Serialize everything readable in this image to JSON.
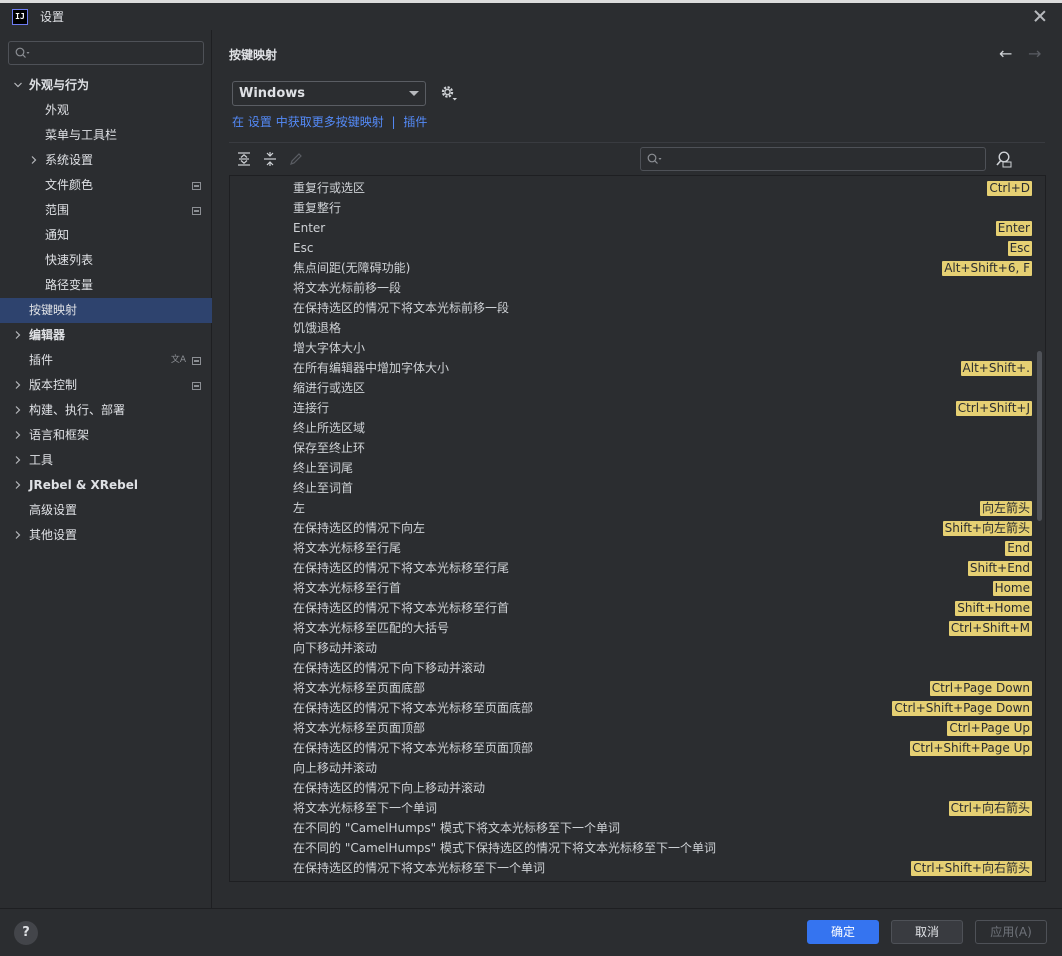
{
  "window": {
    "title": "设置",
    "logo_text": "IJ"
  },
  "sidebar": {
    "search_placeholder": "",
    "items": [
      {
        "label": "外观与行为",
        "level": 0,
        "expanded": true,
        "bold": true
      },
      {
        "label": "外观",
        "level": 1
      },
      {
        "label": "菜单与工具栏",
        "level": 1
      },
      {
        "label": "系统设置",
        "level": 1,
        "collapsed": true
      },
      {
        "label": "文件颜色",
        "level": 1,
        "icon": "project-scope-icon"
      },
      {
        "label": "范围",
        "level": 1,
        "icon": "project-scope-icon"
      },
      {
        "label": "通知",
        "level": 1
      },
      {
        "label": "快速列表",
        "level": 1
      },
      {
        "label": "路径变量",
        "level": 1
      },
      {
        "label": "按键映射",
        "level": 0,
        "selected": true
      },
      {
        "label": "编辑器",
        "level": 0,
        "collapsed": true,
        "bold": true
      },
      {
        "label": "插件",
        "level": 0,
        "icon": "project-scope-icon",
        "translate_icon": true
      },
      {
        "label": "版本控制",
        "level": 0,
        "collapsed": true,
        "icon": "project-scope-icon"
      },
      {
        "label": "构建、执行、部署",
        "level": 0,
        "collapsed": true
      },
      {
        "label": "语言和框架",
        "level": 0,
        "collapsed": true
      },
      {
        "label": "工具",
        "level": 0,
        "collapsed": true
      },
      {
        "label": "JRebel & XRebel",
        "level": 0,
        "collapsed": true,
        "bold": true
      },
      {
        "label": "高级设置",
        "level": 0
      },
      {
        "label": "其他设置",
        "level": 0,
        "collapsed": true
      }
    ]
  },
  "main": {
    "title": "按键映射",
    "keymap_value": "Windows",
    "link": {
      "prefix": "在",
      "settings": "设置",
      "middle": "中获取更多按键映射",
      "sep": "|",
      "plugins": "插件"
    },
    "filter_placeholder": "",
    "actions": [
      {
        "label": "重复行或选区",
        "shortcut": "Ctrl+D"
      },
      {
        "label": "重复整行",
        "shortcut": ""
      },
      {
        "label": "Enter",
        "shortcut": "Enter"
      },
      {
        "label": "Esc",
        "shortcut": "Esc"
      },
      {
        "label": "焦点间距(无障碍功能)",
        "shortcut": "Alt+Shift+6, F"
      },
      {
        "label": "将文本光标前移一段",
        "shortcut": ""
      },
      {
        "label": "在保持选区的情况下将文本光标前移一段",
        "shortcut": ""
      },
      {
        "label": "饥饿退格",
        "shortcut": ""
      },
      {
        "label": "增大字体大小",
        "shortcut": ""
      },
      {
        "label": "在所有编辑器中增加字体大小",
        "shortcut": "Alt+Shift+."
      },
      {
        "label": "缩进行或选区",
        "shortcut": ""
      },
      {
        "label": "连接行",
        "shortcut": "Ctrl+Shift+J"
      },
      {
        "label": "终止所选区域",
        "shortcut": ""
      },
      {
        "label": "保存至终止环",
        "shortcut": ""
      },
      {
        "label": "终止至词尾",
        "shortcut": ""
      },
      {
        "label": "终止至词首",
        "shortcut": ""
      },
      {
        "label": "左",
        "shortcut": "向左箭头"
      },
      {
        "label": "在保持选区的情况下向左",
        "shortcut": "Shift+向左箭头"
      },
      {
        "label": "将文本光标移至行尾",
        "shortcut": "End"
      },
      {
        "label": "在保持选区的情况下将文本光标移至行尾",
        "shortcut": "Shift+End"
      },
      {
        "label": "将文本光标移至行首",
        "shortcut": "Home"
      },
      {
        "label": "在保持选区的情况下将文本光标移至行首",
        "shortcut": "Shift+Home"
      },
      {
        "label": "将文本光标移至匹配的大括号",
        "shortcut": "Ctrl+Shift+M"
      },
      {
        "label": "向下移动并滚动",
        "shortcut": ""
      },
      {
        "label": "在保持选区的情况下向下移动并滚动",
        "shortcut": ""
      },
      {
        "label": "将文本光标移至页面底部",
        "shortcut": "Ctrl+Page Down"
      },
      {
        "label": "在保持选区的情况下将文本光标移至页面底部",
        "shortcut": "Ctrl+Shift+Page Down"
      },
      {
        "label": "将文本光标移至页面顶部",
        "shortcut": "Ctrl+Page Up"
      },
      {
        "label": "在保持选区的情况下将文本光标移至页面顶部",
        "shortcut": "Ctrl+Shift+Page Up"
      },
      {
        "label": "向上移动并滚动",
        "shortcut": ""
      },
      {
        "label": "在保持选区的情况下向上移动并滚动",
        "shortcut": ""
      },
      {
        "label": "将文本光标移至下一个单词",
        "shortcut": "Ctrl+向右箭头"
      },
      {
        "label": "在不同的 \"CamelHumps\" 模式下将文本光标移至下一个单词",
        "shortcut": ""
      },
      {
        "label": "在不同的 \"CamelHumps\" 模式下保持选区的情况下将文本光标移至下一个单词",
        "shortcut": ""
      },
      {
        "label": "在保持选区的情况下将文本光标移至下一个单词",
        "shortcut": "Ctrl+Shift+向右箭头"
      }
    ]
  },
  "footer": {
    "help": "?",
    "ok": "确定",
    "cancel": "取消",
    "apply": "应用(A)"
  },
  "colors": {
    "accent": "#3574f0",
    "selected": "#2e436e",
    "shortcut_bg": "#e6d073",
    "link": "#548af7"
  }
}
